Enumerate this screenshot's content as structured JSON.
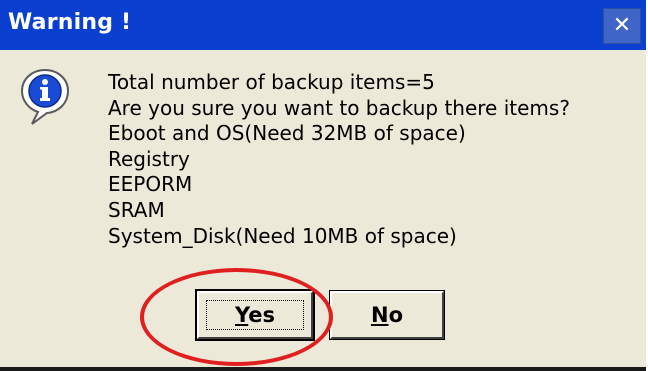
{
  "dialog": {
    "title": "Warning !",
    "close_glyph": "✕",
    "icon": "info-icon",
    "message_lines": [
      "Total number of backup items=5",
      "Are you sure you want to backup there items?",
      "Eboot and OS(Need 32MB of space)",
      "Registry",
      "EEPORM",
      "SRAM",
      "System_Disk(Need 10MB of space)"
    ],
    "buttons": {
      "yes": {
        "label_underlined": "Y",
        "label_rest": "es"
      },
      "no": {
        "label_underlined": "N",
        "label_rest": "o"
      }
    }
  },
  "colors": {
    "titlebar": "#0a3fd0",
    "dialog_background": "#ece9d8",
    "highlight": "#e02020"
  }
}
